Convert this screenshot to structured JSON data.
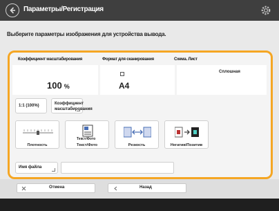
{
  "header": {
    "title": "Параметры/Регистрация"
  },
  "subtitle": "Выберите параметры изображения для устройства вывода.",
  "settings": {
    "ratio_header": "Коэффициент масштабирования",
    "size_header": "Формат для сканирования",
    "layout_header": "Схема. Лист",
    "ratio_value": "100",
    "ratio_unit": "%",
    "size_value": "A4",
    "layout_value": "Сплошная"
  },
  "buttons": {
    "ratio_one": "1:1 (100%)",
    "ratio_custom": "Коэффициент масштабирования"
  },
  "functions": [
    {
      "label": "Плотность",
      "icon": "density-icon"
    },
    {
      "label": "Текст/Фото",
      "icon": "text-photo-icon"
    },
    {
      "label": "Резкость",
      "icon": "sharpness-icon"
    },
    {
      "label": "Негатив/Позитив",
      "icon": "negative-positive-icon"
    }
  ],
  "name": {
    "label": "Имя файла",
    "value": ""
  },
  "footer": {
    "cancel": "Отмена",
    "back": "Назад"
  }
}
